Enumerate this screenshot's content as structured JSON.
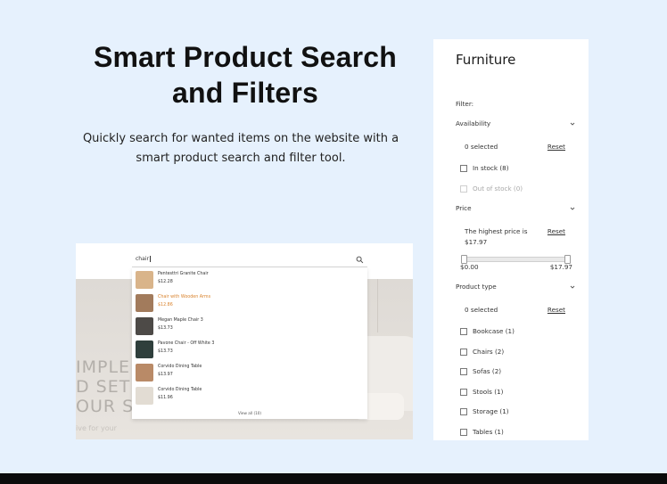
{
  "hero": {
    "title_line1": "Smart Product Search",
    "title_line2": "and Filters",
    "subtitle_line1": "Quickly search for wanted items on the website with a",
    "subtitle_line2": "smart product search and filter tool."
  },
  "search_demo": {
    "query": "chair",
    "results": [
      {
        "name": "Pentesttri Granite Chair",
        "price": "$12.28",
        "thumb": "#d9b48a",
        "highlighted": false
      },
      {
        "name": "Chair with Wooden Arms",
        "price": "$12.86",
        "thumb": "#a27b5c",
        "highlighted": true
      },
      {
        "name": "Megan Maple Chair 3",
        "price": "$13.73",
        "thumb": "#4d4a47",
        "highlighted": false
      },
      {
        "name": "Pavone Chair - Off White 3",
        "price": "$13.73",
        "thumb": "#2f3f3c",
        "highlighted": false
      },
      {
        "name": "Corvido Dining Table",
        "price": "$13.97",
        "thumb": "#b98a67",
        "highlighted": false
      },
      {
        "name": "Corvido Dining Table",
        "price": "$11.96",
        "thumb": "#e2dcd3",
        "highlighted": false
      }
    ],
    "view_all": "View all (10)",
    "bg_text": {
      "line1": "IMPLE Y",
      "line2": "D SETU",
      "line3": "OUR SP",
      "line4": "ive for your"
    }
  },
  "filter_panel": {
    "title": "Furniture",
    "filter_label": "Filter:",
    "availability": {
      "label": "Availability",
      "selected": "0 selected",
      "reset": "Reset",
      "options": [
        {
          "label": "In stock (8)",
          "disabled": false
        },
        {
          "label": "Out of stock (0)",
          "disabled": true
        }
      ]
    },
    "price": {
      "label": "Price",
      "highest_line1": "The highest price is",
      "highest_line2": "$17.97",
      "reset": "Reset",
      "min_label": "$0.00",
      "max_label": "$17.97",
      "range_min_fraction": 0,
      "range_max_fraction": 1
    },
    "product_type": {
      "label": "Product type",
      "selected": "0 selected",
      "reset": "Reset",
      "options": [
        {
          "label": "Bookcase (1)"
        },
        {
          "label": "Chairs (2)"
        },
        {
          "label": "Sofas (2)"
        },
        {
          "label": "Stools (1)"
        },
        {
          "label": "Storage (1)"
        },
        {
          "label": "Tables (1)"
        }
      ]
    }
  },
  "colors": {
    "page_bg": "#e6f1fd",
    "highlight": "#d9822b"
  }
}
